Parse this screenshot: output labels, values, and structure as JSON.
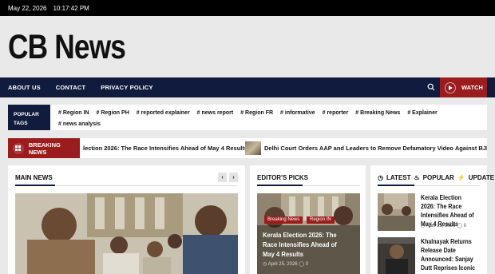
{
  "topbar": {
    "date": "May 22, 2026",
    "time": "10:17:42 PM"
  },
  "site": {
    "logo": "CB News"
  },
  "nav": {
    "items": [
      "ABOUT US",
      "CONTACT",
      "PRIVACY POLICY"
    ],
    "watch_label": "WATCH"
  },
  "tags": {
    "label_line1": "POPULAR",
    "label_line2": "TAGS",
    "items": [
      "# Region IN",
      "# Region PH",
      "# reported explainer",
      "# news report",
      "# Region FR",
      "# informative",
      "# reporter",
      "# Breaking News",
      "# Explainer",
      "# news analysis"
    ]
  },
  "breaking": {
    "label": "BREAKING NEWS",
    "items": [
      "lection 2026: The Race Intensifies Ahead of May 4 Results",
      "Delhi Court Orders AAP and Leaders to Remove Defamatory Video Against BJP MP Bans"
    ]
  },
  "main_news": {
    "title": "MAIN NEWS",
    "prev": "‹",
    "next": "›"
  },
  "editors": {
    "title": "EDITOR'S PICKS",
    "badges": [
      "Breaking News",
      "Region IN"
    ],
    "headline": "Kerala Election 2026: The Race Intensifies Ahead of May 4 Results",
    "date": "April 25, 2026",
    "comments": "0"
  },
  "sidebar": {
    "tabs": [
      "LATEST",
      "POPULAR",
      "UPDATE"
    ],
    "items": [
      {
        "title": "Kerala Election 2026: The Race Intensifies Ahead of May 4 Results",
        "date": "April 25, 2026",
        "comments": "0"
      },
      {
        "title": "Khalnayak Returns Release Date Announced: Sanjay Dutt Reprises Iconic",
        "date": "",
        "comments": ""
      }
    ]
  },
  "colors": {
    "navy": "#111b3d",
    "red": "#9b1c1c"
  }
}
